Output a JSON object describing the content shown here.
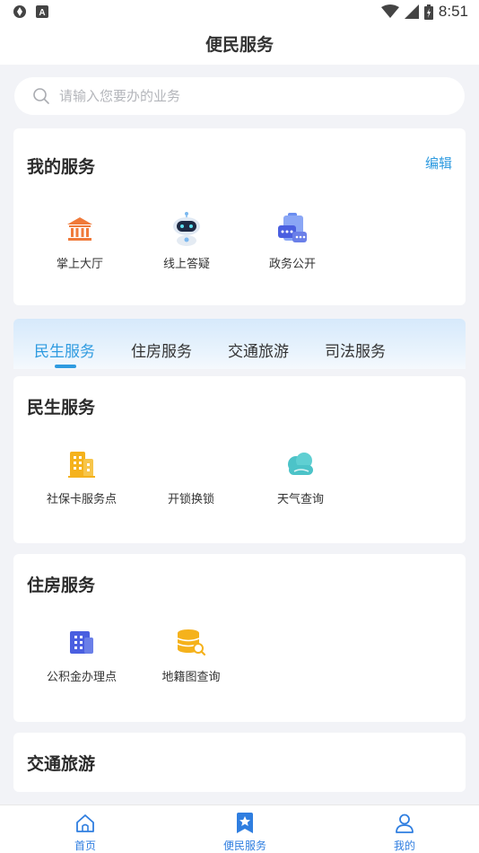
{
  "statusbar": {
    "time": "8:51"
  },
  "header": {
    "title": "便民服务"
  },
  "search": {
    "placeholder": "请输入您要办的业务"
  },
  "my_services": {
    "title": "我的服务",
    "edit_label": "编辑",
    "items": [
      {
        "label": "掌上大厅",
        "icon": "hall-building-icon"
      },
      {
        "label": "线上答疑",
        "icon": "robot-icon"
      },
      {
        "label": "政务公开",
        "icon": "chat-clipboard-icon"
      }
    ]
  },
  "tabs": [
    {
      "label": "民生服务",
      "active": true
    },
    {
      "label": "住房服务",
      "active": false
    },
    {
      "label": "交通旅游",
      "active": false
    },
    {
      "label": "司法服务",
      "active": false
    }
  ],
  "sections": [
    {
      "title": "民生服务",
      "items": [
        {
          "label": "社保卡服务点",
          "icon": "office-building-icon"
        },
        {
          "label": "开锁换锁",
          "icon": "lock-icon"
        },
        {
          "label": "天气查询",
          "icon": "cloud-icon"
        }
      ]
    },
    {
      "title": "住房服务",
      "items": [
        {
          "label": "公积金办理点",
          "icon": "apartment-building-icon"
        },
        {
          "label": "地籍图查询",
          "icon": "coin-search-icon"
        }
      ]
    },
    {
      "title": "交通旅游",
      "items": []
    }
  ],
  "bottom_nav": [
    {
      "label": "首页",
      "icon": "home-icon"
    },
    {
      "label": "便民服务",
      "icon": "bookmark-star-icon"
    },
    {
      "label": "我的",
      "icon": "user-icon"
    }
  ],
  "colors": {
    "accent": "#2f9be0",
    "nav_accent": "#2f7ee0",
    "orange": "#f07a3a",
    "gold": "#f5b21c",
    "teal": "#4cc3c8",
    "indigo": "#4a5fe0"
  }
}
